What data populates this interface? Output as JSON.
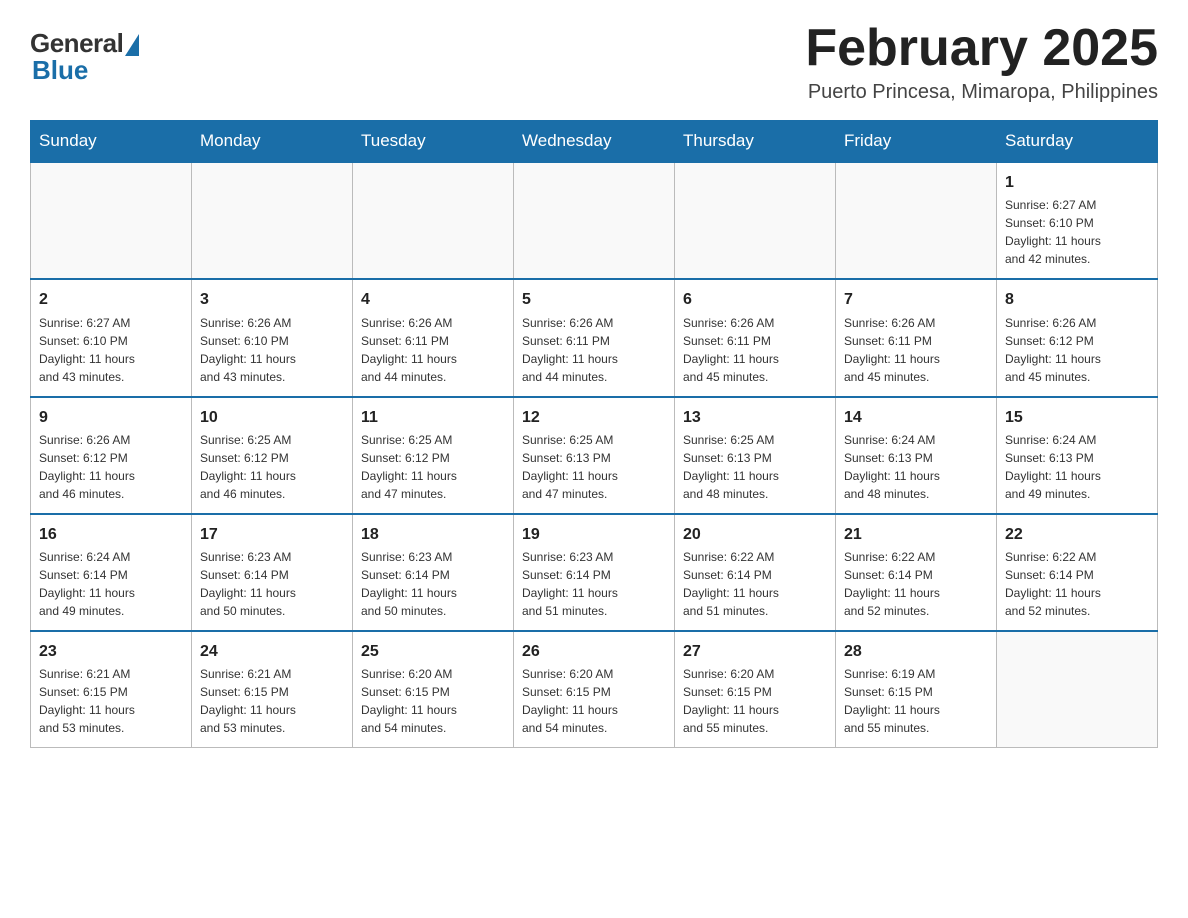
{
  "logo": {
    "general": "General",
    "blue": "Blue"
  },
  "header": {
    "month_year": "February 2025",
    "location": "Puerto Princesa, Mimaropa, Philippines"
  },
  "weekdays": [
    "Sunday",
    "Monday",
    "Tuesday",
    "Wednesday",
    "Thursday",
    "Friday",
    "Saturday"
  ],
  "weeks": [
    [
      {
        "day": "",
        "info": ""
      },
      {
        "day": "",
        "info": ""
      },
      {
        "day": "",
        "info": ""
      },
      {
        "day": "",
        "info": ""
      },
      {
        "day": "",
        "info": ""
      },
      {
        "day": "",
        "info": ""
      },
      {
        "day": "1",
        "info": "Sunrise: 6:27 AM\nSunset: 6:10 PM\nDaylight: 11 hours\nand 42 minutes."
      }
    ],
    [
      {
        "day": "2",
        "info": "Sunrise: 6:27 AM\nSunset: 6:10 PM\nDaylight: 11 hours\nand 43 minutes."
      },
      {
        "day": "3",
        "info": "Sunrise: 6:26 AM\nSunset: 6:10 PM\nDaylight: 11 hours\nand 43 minutes."
      },
      {
        "day": "4",
        "info": "Sunrise: 6:26 AM\nSunset: 6:11 PM\nDaylight: 11 hours\nand 44 minutes."
      },
      {
        "day": "5",
        "info": "Sunrise: 6:26 AM\nSunset: 6:11 PM\nDaylight: 11 hours\nand 44 minutes."
      },
      {
        "day": "6",
        "info": "Sunrise: 6:26 AM\nSunset: 6:11 PM\nDaylight: 11 hours\nand 45 minutes."
      },
      {
        "day": "7",
        "info": "Sunrise: 6:26 AM\nSunset: 6:11 PM\nDaylight: 11 hours\nand 45 minutes."
      },
      {
        "day": "8",
        "info": "Sunrise: 6:26 AM\nSunset: 6:12 PM\nDaylight: 11 hours\nand 45 minutes."
      }
    ],
    [
      {
        "day": "9",
        "info": "Sunrise: 6:26 AM\nSunset: 6:12 PM\nDaylight: 11 hours\nand 46 minutes."
      },
      {
        "day": "10",
        "info": "Sunrise: 6:25 AM\nSunset: 6:12 PM\nDaylight: 11 hours\nand 46 minutes."
      },
      {
        "day": "11",
        "info": "Sunrise: 6:25 AM\nSunset: 6:12 PM\nDaylight: 11 hours\nand 47 minutes."
      },
      {
        "day": "12",
        "info": "Sunrise: 6:25 AM\nSunset: 6:13 PM\nDaylight: 11 hours\nand 47 minutes."
      },
      {
        "day": "13",
        "info": "Sunrise: 6:25 AM\nSunset: 6:13 PM\nDaylight: 11 hours\nand 48 minutes."
      },
      {
        "day": "14",
        "info": "Sunrise: 6:24 AM\nSunset: 6:13 PM\nDaylight: 11 hours\nand 48 minutes."
      },
      {
        "day": "15",
        "info": "Sunrise: 6:24 AM\nSunset: 6:13 PM\nDaylight: 11 hours\nand 49 minutes."
      }
    ],
    [
      {
        "day": "16",
        "info": "Sunrise: 6:24 AM\nSunset: 6:14 PM\nDaylight: 11 hours\nand 49 minutes."
      },
      {
        "day": "17",
        "info": "Sunrise: 6:23 AM\nSunset: 6:14 PM\nDaylight: 11 hours\nand 50 minutes."
      },
      {
        "day": "18",
        "info": "Sunrise: 6:23 AM\nSunset: 6:14 PM\nDaylight: 11 hours\nand 50 minutes."
      },
      {
        "day": "19",
        "info": "Sunrise: 6:23 AM\nSunset: 6:14 PM\nDaylight: 11 hours\nand 51 minutes."
      },
      {
        "day": "20",
        "info": "Sunrise: 6:22 AM\nSunset: 6:14 PM\nDaylight: 11 hours\nand 51 minutes."
      },
      {
        "day": "21",
        "info": "Sunrise: 6:22 AM\nSunset: 6:14 PM\nDaylight: 11 hours\nand 52 minutes."
      },
      {
        "day": "22",
        "info": "Sunrise: 6:22 AM\nSunset: 6:14 PM\nDaylight: 11 hours\nand 52 minutes."
      }
    ],
    [
      {
        "day": "23",
        "info": "Sunrise: 6:21 AM\nSunset: 6:15 PM\nDaylight: 11 hours\nand 53 minutes."
      },
      {
        "day": "24",
        "info": "Sunrise: 6:21 AM\nSunset: 6:15 PM\nDaylight: 11 hours\nand 53 minutes."
      },
      {
        "day": "25",
        "info": "Sunrise: 6:20 AM\nSunset: 6:15 PM\nDaylight: 11 hours\nand 54 minutes."
      },
      {
        "day": "26",
        "info": "Sunrise: 6:20 AM\nSunset: 6:15 PM\nDaylight: 11 hours\nand 54 minutes."
      },
      {
        "day": "27",
        "info": "Sunrise: 6:20 AM\nSunset: 6:15 PM\nDaylight: 11 hours\nand 55 minutes."
      },
      {
        "day": "28",
        "info": "Sunrise: 6:19 AM\nSunset: 6:15 PM\nDaylight: 11 hours\nand 55 minutes."
      },
      {
        "day": "",
        "info": ""
      }
    ]
  ]
}
